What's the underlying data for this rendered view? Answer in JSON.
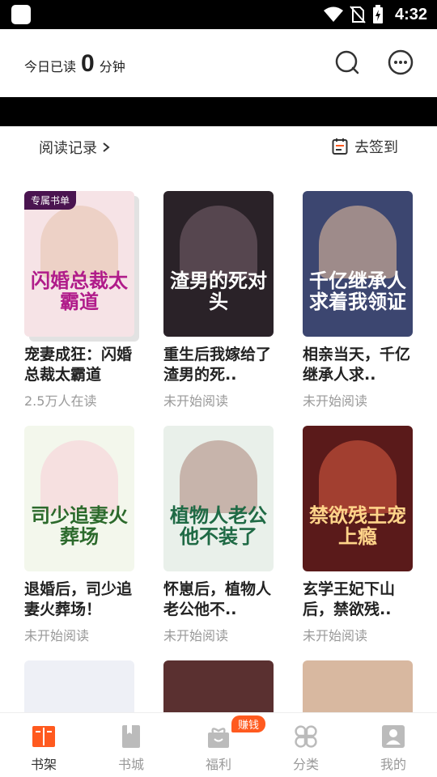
{
  "status_bar": {
    "time": "4:32"
  },
  "header": {
    "read_prefix": "今日已读",
    "read_minutes": "0",
    "read_suffix": "分钟"
  },
  "subbar": {
    "history_label": "阅读记录",
    "checkin_label": "去签到"
  },
  "books": [
    {
      "title": "宠妻成狂：闪婚总裁太霸道",
      "status": "2.5万人在读",
      "badge": "专属书单",
      "cover_text": "闪婚总裁太霸道",
      "cover_bg": "#f6e3e6",
      "cover_color": "#b01c8a"
    },
    {
      "title": "重生后我嫁给了渣男的死..",
      "status": "未开始阅读",
      "cover_text": "渣男的死对头",
      "cover_bg": "#2a2228",
      "cover_color": "#ffffff"
    },
    {
      "title": "相亲当天，千亿继承人求..",
      "status": "未开始阅读",
      "cover_text": "千亿继承人求着我领证",
      "cover_bg": "#3c4670",
      "cover_color": "#ffffff"
    },
    {
      "title": "退婚后，司少追妻火葬场！",
      "status": "未开始阅读",
      "cover_text": "司少追妻火葬场",
      "cover_bg": "#f3f7ec",
      "cover_color": "#2c6a2c"
    },
    {
      "title": "怀崽后，植物人老公他不..",
      "status": "未开始阅读",
      "cover_text": "植物人老公他不装了",
      "cover_bg": "#e9f0ea",
      "cover_color": "#1f6a45"
    },
    {
      "title": "玄学王妃下山后，禁欲残..",
      "status": "未开始阅读",
      "cover_text": "禁欲残王宠上瘾",
      "cover_bg": "#5a1a1a",
      "cover_color": "#ffd48a"
    }
  ],
  "tabs": [
    {
      "label": "书架",
      "icon": "bookshelf-icon",
      "active": true
    },
    {
      "label": "书城",
      "icon": "book-icon",
      "active": false
    },
    {
      "label": "福利",
      "icon": "gift-icon",
      "active": false
    },
    {
      "label": "分类",
      "icon": "category-icon",
      "active": false
    },
    {
      "label": "我的",
      "icon": "profile-icon",
      "active": false
    }
  ],
  "earn_badge": "赚钱",
  "colors": {
    "accent": "#ff5a1f",
    "badge_bg": "#4a1450",
    "muted": "#999999"
  }
}
